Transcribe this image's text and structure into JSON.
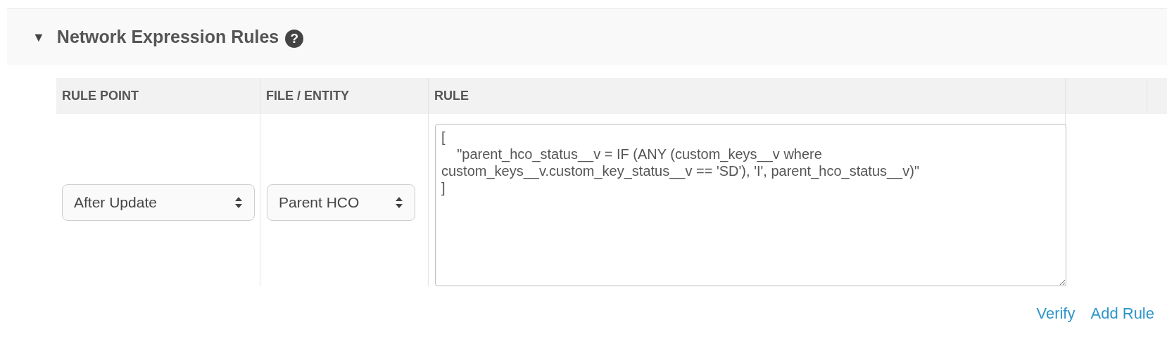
{
  "section": {
    "title": "Network Expression Rules",
    "expanded": true,
    "toggle": "▼",
    "help": "?"
  },
  "table": {
    "columns": [
      "RULE POINT",
      "FILE / ENTITY",
      "RULE"
    ],
    "rows": [
      {
        "rule_point": "After Update",
        "file_entity": "Parent HCO",
        "rule": "[\n    \"parent_hco_status__v = IF (ANY (custom_keys__v where custom_keys__v.custom_key_status__v == 'SD'), 'I', parent_hco_status__v)\"\n]"
      }
    ]
  },
  "actions": [
    "Verify",
    "Add Rule"
  ]
}
